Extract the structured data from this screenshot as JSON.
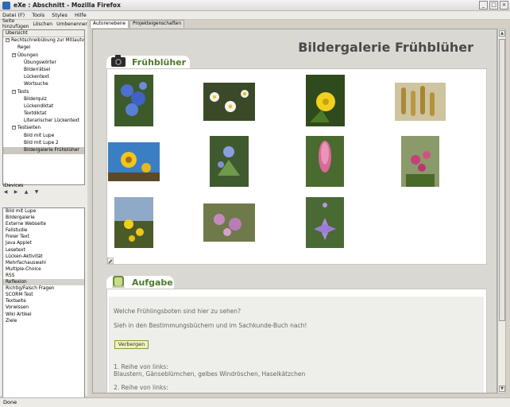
{
  "window": {
    "title": "eXe : Abschnitt - Mozilla Firefox"
  },
  "menu": [
    "Datei (F)",
    "Tools",
    "Styles",
    "Hilfe"
  ],
  "left_toolbar": [
    "Seite hinzufügen",
    "Löschen",
    "Umbenennen"
  ],
  "outline": {
    "root": "Übersicht",
    "items": [
      {
        "label": "Rechtschreibübung zur Mitlautverdo...",
        "level": 0,
        "toggle": "−"
      },
      {
        "label": "Regel",
        "level": 1
      },
      {
        "label": "Übungen",
        "level": 1,
        "toggle": "−"
      },
      {
        "label": "Übungswörter",
        "level": 2
      },
      {
        "label": "Bilderrätsel",
        "level": 2
      },
      {
        "label": "Lückentext",
        "level": 2
      },
      {
        "label": "Wortsuche",
        "level": 2
      },
      {
        "label": "Tests",
        "level": 1,
        "toggle": "−"
      },
      {
        "label": "Bilderquiz",
        "level": 2
      },
      {
        "label": "Lückendiktat",
        "level": 2
      },
      {
        "label": "Textdiktat",
        "level": 2
      },
      {
        "label": "Literarischer Lückentext",
        "level": 2
      },
      {
        "label": "Testseiten",
        "level": 1,
        "toggle": "−"
      },
      {
        "label": "Bild mit Lupe",
        "level": 2
      },
      {
        "label": "Bild mit Lupe 2",
        "level": 2
      },
      {
        "label": "Bildergalerie Frühblüher",
        "level": 2,
        "selected": true
      }
    ]
  },
  "idevices": {
    "label": "iDevices",
    "items": [
      "Bild mit Lupe",
      "Bildergalerie",
      "Externe Webseite",
      "Fallstudie",
      "Freier Text",
      "Java Applet",
      "Lesetext",
      "Lücken-Aktivität",
      "Mehrfachauswahl",
      "Multiple-Choice",
      "RSS",
      "Reflexion",
      "Richtig/Falsch Fragen",
      "SCORM Test",
      "Textseite",
      "Vorwissen",
      "Wiki Artikel",
      "Ziele"
    ],
    "selected_index": 11
  },
  "tabs": [
    "Autorenebene",
    "Projekteigenschaften"
  ],
  "content": {
    "page_title": "Bildergalerie Frühblüher",
    "gallery_title": "Frühblüher",
    "aufgabe_title": "Aufgabe",
    "question": "Welche Frühlingsboten sind hier zu sehen?",
    "hint": "Sieh in den Bestimmungsbüchern und im Sachkunde-Buch nach!",
    "hide_button": "Verbergen",
    "answer1_heading": "1. Reihe von links:",
    "answer1_text": "Blaustern, Gänseblümchen, gelbes Windröschen, Haselkätzchen",
    "answer2_heading": "2. Reihe von links:"
  },
  "status": "Done"
}
